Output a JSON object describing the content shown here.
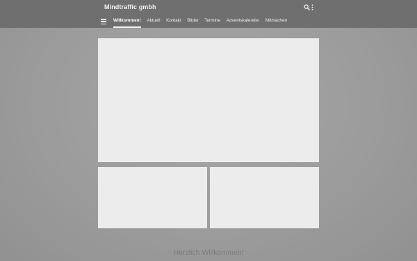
{
  "header": {
    "site_title": "Mindtraffic gmbh",
    "icons": [
      "search-icon",
      "more-vertical-icon"
    ]
  },
  "nav": {
    "menu_icon": "hamburger-menu-icon",
    "items": [
      {
        "label": "Willkommen!",
        "active": true
      },
      {
        "label": "Aktuell",
        "active": false
      },
      {
        "label": "Kontakt",
        "active": false
      },
      {
        "label": "Bilder",
        "active": false
      },
      {
        "label": "Termine",
        "active": false
      },
      {
        "label": "Adventskalender",
        "active": false
      },
      {
        "label": "Mitmachen",
        "active": false
      }
    ]
  },
  "main": {
    "welcome_text": "Herzlich Willkommen!"
  },
  "colors": {
    "header_bg": "#6f6f6f",
    "page_bg": "#9e9e9e",
    "panel_bg": "#ececec",
    "welcome_text": "#7a7a7a"
  }
}
